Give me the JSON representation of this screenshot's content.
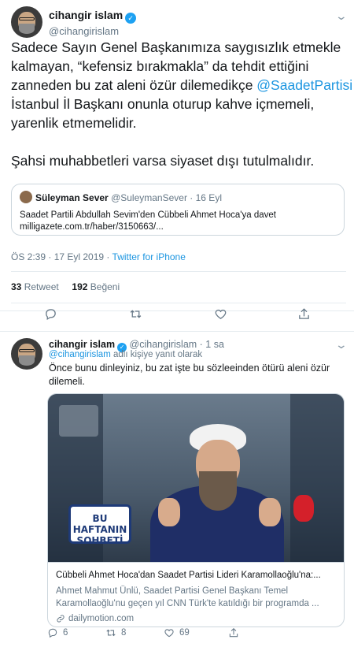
{
  "main_tweet": {
    "display_name": "cihangir islam",
    "handle": "@cihangirislam",
    "lines": [
      "Sadece Sayın Genel Başkanımıza saygısızlık etmekle",
      "kalmayan, “kefensiz bırakmakla” da tehdit ettiğini",
      "zanneden bu zat aleni özür dilemedikçe ",
      "İstanbul İl Başkanı onunla oturup kahve içmemeli,",
      "yarenlik etmemelidir."
    ],
    "mention": "@SaadetPartisi",
    "line_after": "Şahsi muhabbetleri varsa siyaset dışı tutulmalıdır.",
    "quote": {
      "name": "Süleyman Sever",
      "handle": "@SuleymanSever",
      "date": "· 16 Eyl",
      "text_line1": "Saadet Partili Abdullah Sevim'den Cübbeli Ahmet Hoca'ya davet",
      "text_line2": "milligazete.com.tr/haber/3150663/..."
    },
    "timestamp": "ÖS 2:39 · 17 Eyl 2019 · ",
    "source": "Twitter for iPhone",
    "retweet_count": "33",
    "retweet_label": "Retweet",
    "like_count": "192",
    "like_label": "Beğeni"
  },
  "reply_tweet": {
    "display_name": "cihangir islam",
    "handle": "@cihangirislam",
    "time": "· 1 sa",
    "reply_to_mention": "@cihangirislam",
    "reply_to_suffix": " adlı kişiye yanıt olarak",
    "text_line1": "Önce bunu dinleyiniz, bu zat işte bu sözleeinden ötürü aleni özür",
    "text_line2": "dilemeli.",
    "card": {
      "video_badge_line1": "BU HAFTANIN",
      "video_badge_line2": "SOHBETİ",
      "title": "Cübbeli Ahmet Hoca'dan Saadet Partisi Lideri Karamollaoğlu'na:...",
      "desc_line1": "Ahmet Mahmut Ünlü, Saadet Partisi Genel Başkanı Temel",
      "desc_line2": "Karamollaoğlu'nu geçen yıl CNN Türk'te katıldığı bir programda ...",
      "link": "dailymotion.com"
    },
    "reply_count": "6",
    "retweet_count": "8",
    "like_count": "69"
  },
  "icons": [
    "verified-icon",
    "chevron-down-icon",
    "reply-icon",
    "retweet-icon",
    "like-icon",
    "share-icon",
    "link-icon"
  ]
}
